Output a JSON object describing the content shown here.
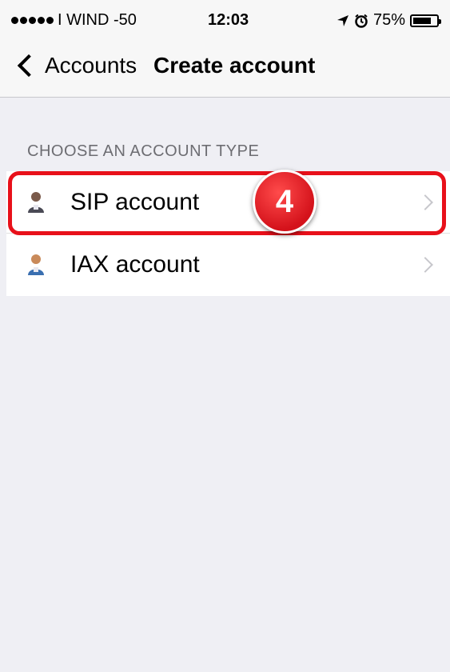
{
  "status_bar": {
    "carrier": "I WIND  -50",
    "time": "12:03",
    "battery": "75%"
  },
  "nav": {
    "back_label": "Accounts",
    "title": "Create account"
  },
  "section_header": "CHOOSE AN ACCOUNT TYPE",
  "accounts": [
    {
      "label": "SIP account"
    },
    {
      "label": "IAX account"
    }
  ],
  "annotation": {
    "step_number": "4",
    "color": "#e8101a"
  },
  "icons": [
    "user-icon",
    "chevron-right-icon",
    "location-arrow-icon",
    "alarm-icon",
    "battery-icon"
  ]
}
